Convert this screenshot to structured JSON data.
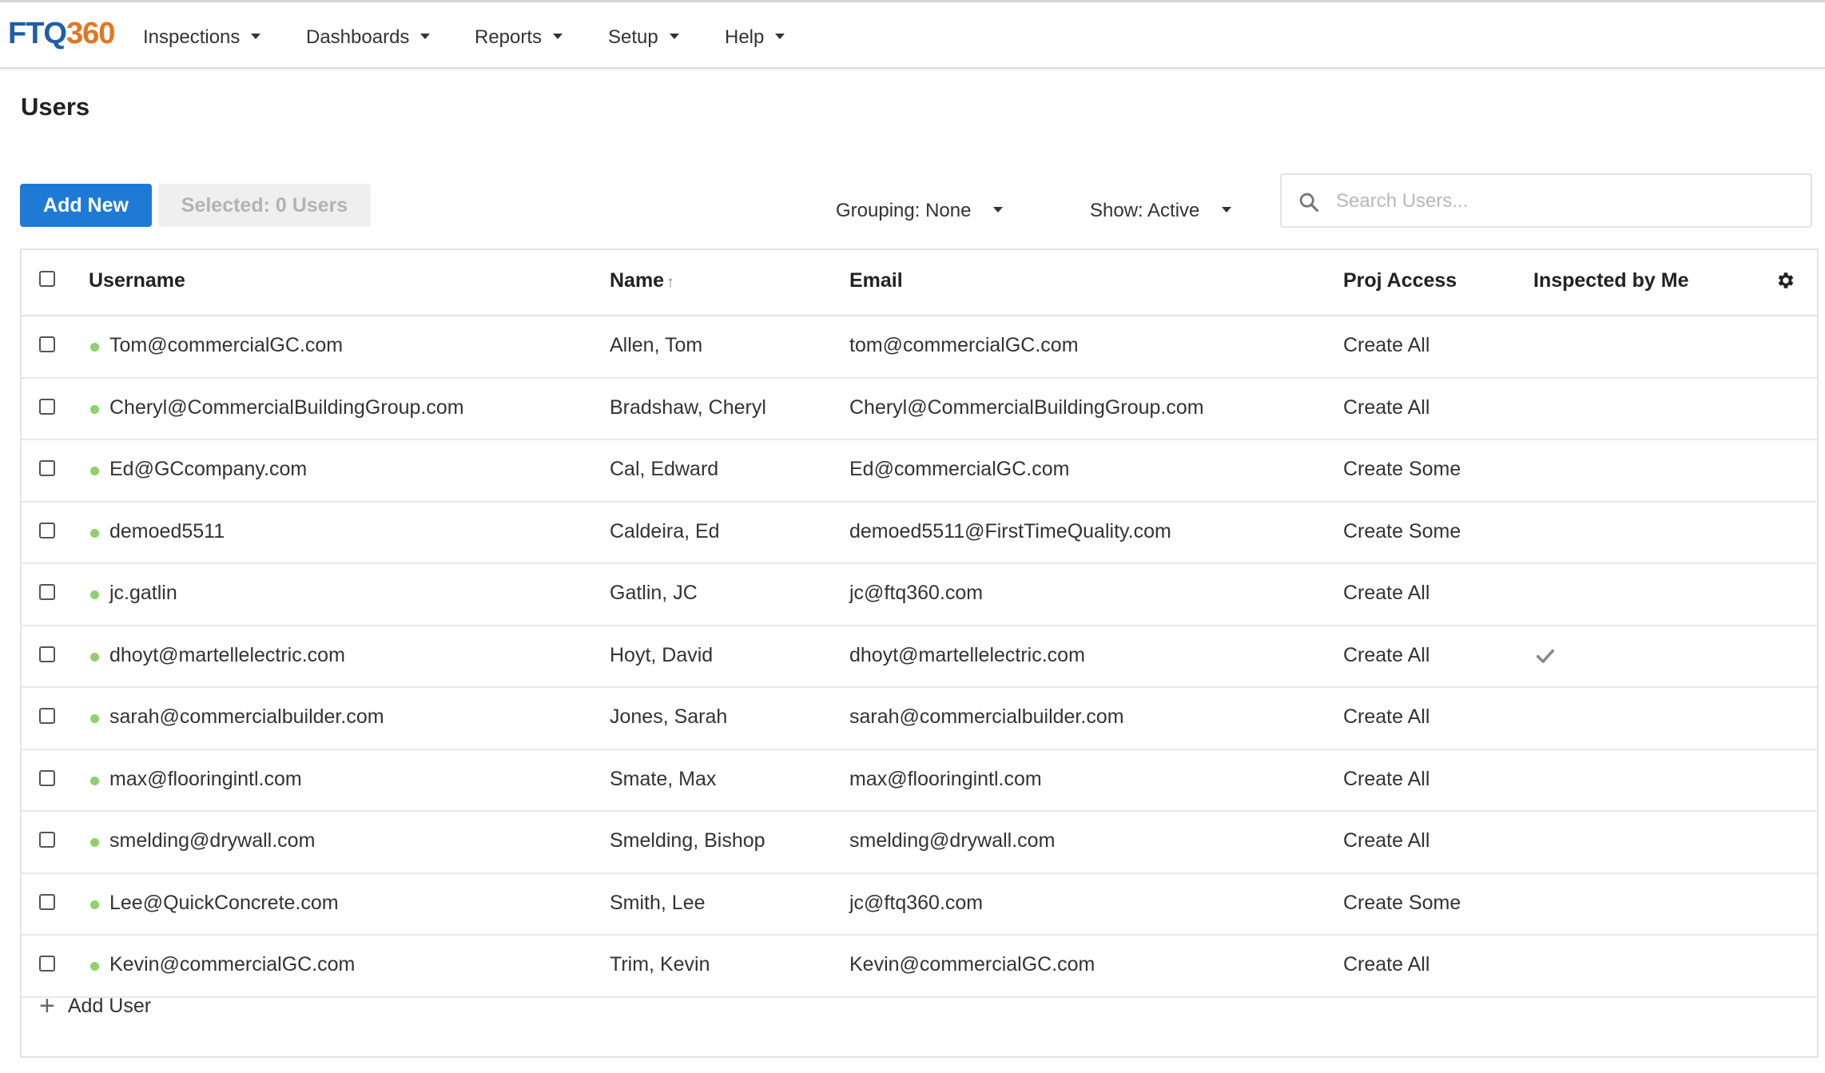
{
  "app": {
    "logo_left": "FTQ",
    "logo_right": "360",
    "nav": [
      {
        "label": "Inspections"
      },
      {
        "label": "Dashboards"
      },
      {
        "label": "Reports"
      },
      {
        "label": "Setup"
      },
      {
        "label": "Help"
      }
    ]
  },
  "page": {
    "title": "Users",
    "add_new_label": "Add New",
    "selected_label": "Selected: 0 Users",
    "grouping_label": "Grouping: None",
    "show_label": "Show: Active",
    "search_placeholder": "Search Users..."
  },
  "table": {
    "columns": {
      "username": "Username",
      "name": "Name",
      "email": "Email",
      "proj_access": "Proj Access",
      "inspected_by_me": "Inspected by Me"
    },
    "sort_indicator": "↑",
    "rows": [
      {
        "username": "Tom@commercialGC.com",
        "name": "Allen, Tom",
        "email": "tom@commercialGC.com",
        "access": "Create All",
        "inspected": false
      },
      {
        "username": "Cheryl@CommercialBuildingGroup.com",
        "name": "Bradshaw, Cheryl",
        "email": "Cheryl@CommercialBuildingGroup.com",
        "access": "Create All",
        "inspected": false
      },
      {
        "username": "Ed@GCcompany.com",
        "name": "Cal, Edward",
        "email": "Ed@commercialGC.com",
        "access": "Create Some",
        "inspected": false
      },
      {
        "username": "demoed5511",
        "name": "Caldeira, Ed",
        "email": "demoed5511@FirstTimeQuality.com",
        "access": "Create Some",
        "inspected": false
      },
      {
        "username": "jc.gatlin",
        "name": "Gatlin, JC",
        "email": "jc@ftq360.com",
        "access": "Create All",
        "inspected": false
      },
      {
        "username": "dhoyt@martellelectric.com",
        "name": "Hoyt, David",
        "email": "dhoyt@martellelectric.com",
        "access": "Create All",
        "inspected": true
      },
      {
        "username": "sarah@commercialbuilder.com",
        "name": "Jones, Sarah",
        "email": "sarah@commercialbuilder.com",
        "access": "Create All",
        "inspected": false
      },
      {
        "username": "max@flooringintl.com",
        "name": "Smate, Max",
        "email": "max@flooringintl.com",
        "access": "Create All",
        "inspected": false
      },
      {
        "username": "smelding@drywall.com",
        "name": "Smelding, Bishop",
        "email": "smelding@drywall.com",
        "access": "Create All",
        "inspected": false
      },
      {
        "username": "Lee@QuickConcrete.com",
        "name": "Smith, Lee",
        "email": "jc@ftq360.com",
        "access": "Create Some",
        "inspected": false
      },
      {
        "username": "Kevin@commercialGC.com",
        "name": "Trim, Kevin",
        "email": "Kevin@commercialGC.com",
        "access": "Create All",
        "inspected": false
      }
    ],
    "add_user_label": "Add User"
  },
  "icons": {
    "search": "search-icon",
    "settings": "gear-icon",
    "checkmark": "check-icon",
    "caret": "caret-down-icon",
    "add": "plus-icon",
    "status": "status-dot"
  },
  "colors": {
    "primary": "#1f7ad6",
    "logo_blue": "#1f5ea8",
    "logo_orange": "#e4761f",
    "active_dot": "#8fd16a"
  }
}
